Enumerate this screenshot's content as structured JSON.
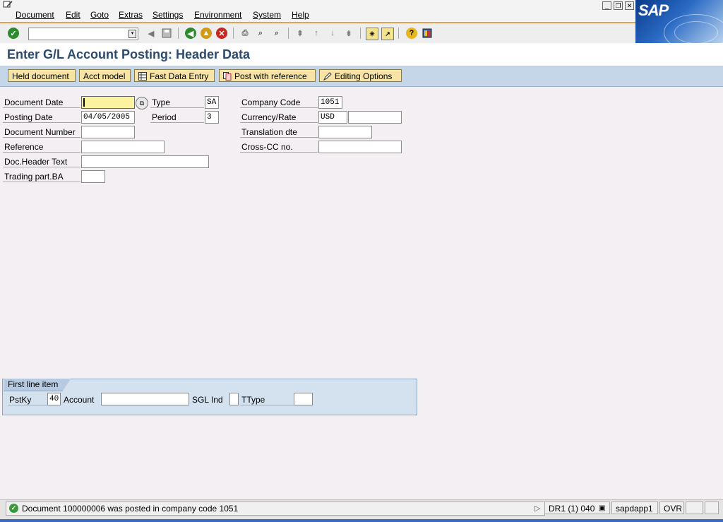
{
  "menu": {
    "items": [
      {
        "label": "Document"
      },
      {
        "label": "Edit"
      },
      {
        "label": "Goto"
      },
      {
        "label": "Extras"
      },
      {
        "label": "Settings"
      },
      {
        "label": "Environment"
      },
      {
        "label": "System"
      },
      {
        "label": "Help"
      }
    ],
    "logo_text": "SAP"
  },
  "toolbar": {
    "command_field_value": "",
    "icons": [
      "enter-icon",
      "back-arrow-icon",
      "save-icon",
      "back-icon",
      "exit-icon",
      "cancel-icon",
      "print-icon",
      "find-icon",
      "find-next-icon",
      "first-page-icon",
      "previous-page-icon",
      "next-page-icon",
      "last-page-icon",
      "create-session-icon",
      "shortcut-icon",
      "help-icon",
      "customize-layout-icon"
    ]
  },
  "title": "Enter G/L Account Posting: Header Data",
  "app_toolbar": {
    "held_document": "Held document",
    "acct_model": "Acct model",
    "fast_data_entry": "Fast Data Entry",
    "post_with_reference": "Post with reference",
    "editing_options": "Editing Options"
  },
  "form": {
    "document_date": {
      "label": "Document Date",
      "value": ""
    },
    "type": {
      "label": "Type",
      "value": "SA"
    },
    "company_code": {
      "label": "Company Code",
      "value": "1051"
    },
    "posting_date": {
      "label": "Posting Date",
      "value": "04/05/2005"
    },
    "period": {
      "label": "Period",
      "value": "3"
    },
    "currency_rate": {
      "label": "Currency/Rate",
      "value": "USD",
      "rate": ""
    },
    "document_number": {
      "label": "Document Number",
      "value": ""
    },
    "translation_date": {
      "label": "Translation dte",
      "value": ""
    },
    "reference": {
      "label": "Reference",
      "value": ""
    },
    "cross_cc_no": {
      "label": "Cross-CC no.",
      "value": ""
    },
    "doc_header_text": {
      "label": "Doc.Header Text",
      "value": ""
    },
    "trading_part_ba": {
      "label": "Trading part.BA",
      "value": ""
    }
  },
  "first_line_item": {
    "title": "First line item",
    "pstky": {
      "label": "PstKy",
      "value": "40"
    },
    "account": {
      "label": "Account",
      "value": ""
    },
    "sgl_ind": {
      "label": "SGL Ind",
      "value": ""
    },
    "ttype": {
      "label": "TType",
      "value": ""
    }
  },
  "status": {
    "message": "Document 100000006 was posted in company code 1051",
    "system": "DR1 (1) 040",
    "server": "sapdapp1",
    "mode": "OVR"
  },
  "colors": {
    "accent_orange": "#e6a34e",
    "title_blue": "#2b4a6f",
    "app_toolbar_bg": "#c5d6e8",
    "button_yellow": "#f6e3a5",
    "active_field": "#fbf3a0"
  }
}
